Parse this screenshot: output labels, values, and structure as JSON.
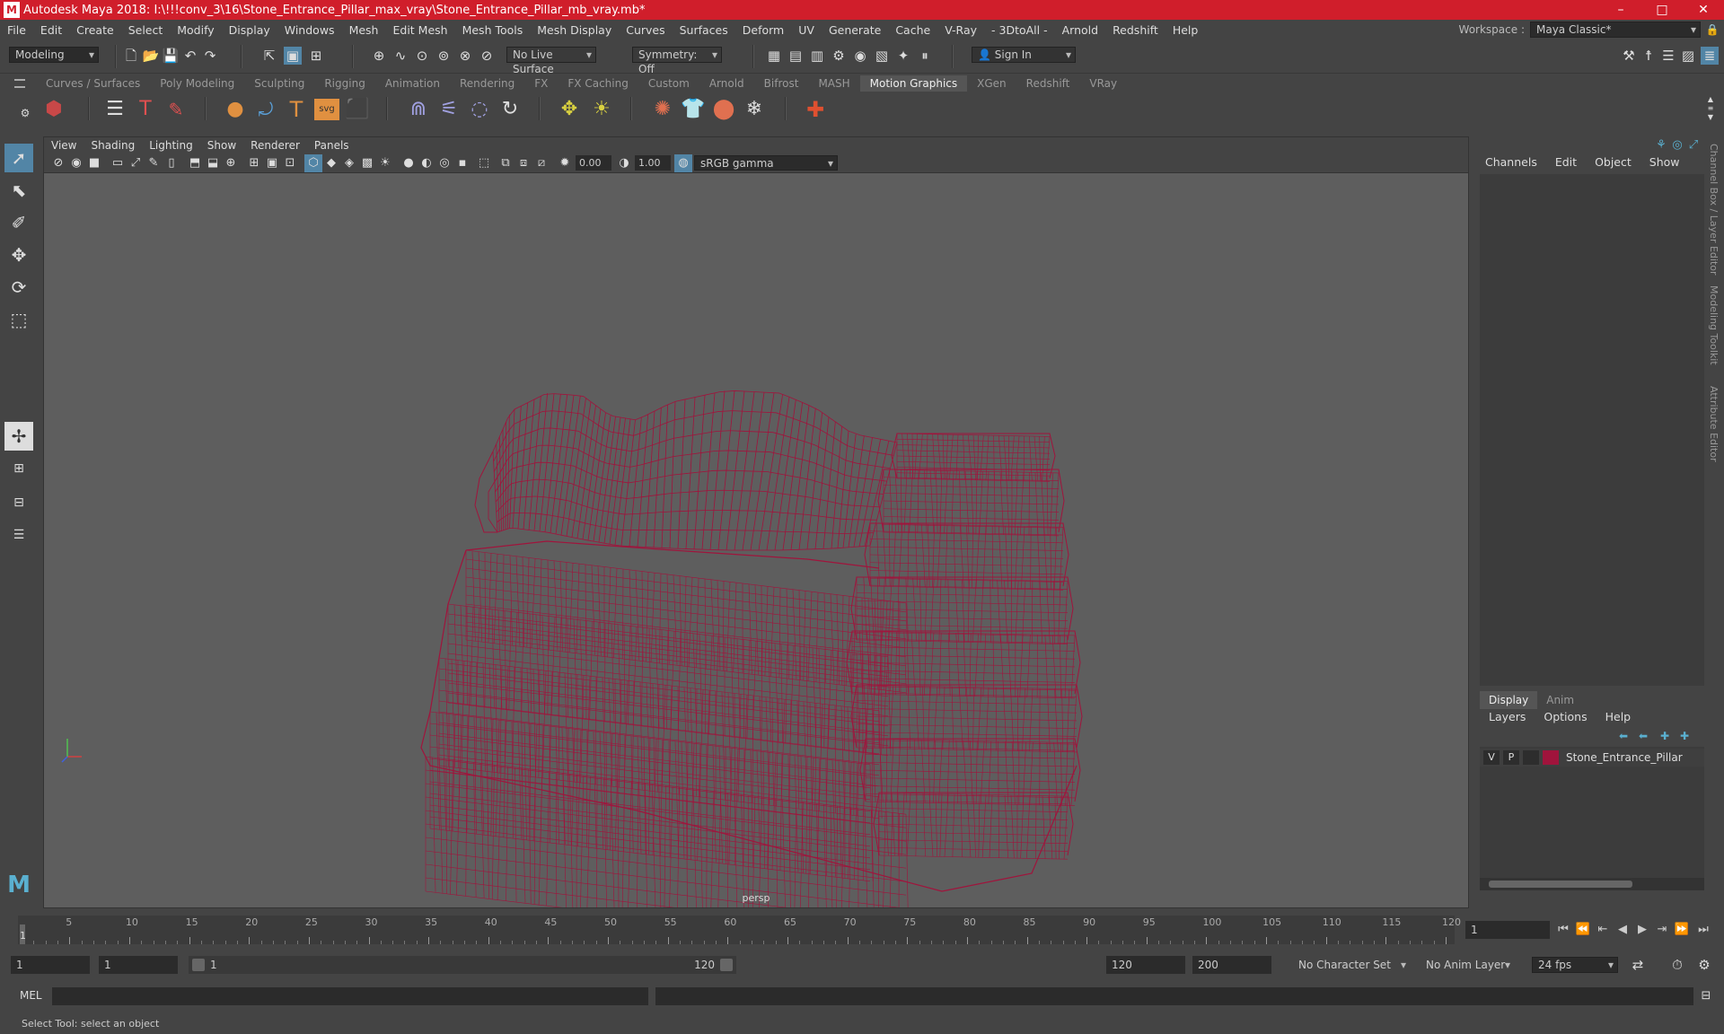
{
  "window": {
    "title": "Autodesk Maya 2018: I:\\!!!conv_3\\16\\Stone_Entrance_Pillar_max_vray\\Stone_Entrance_Pillar_mb_vray.mb*",
    "minimize": "–",
    "maximize": "□",
    "close": "✕"
  },
  "menubar": {
    "items": [
      "File",
      "Edit",
      "Create",
      "Select",
      "Modify",
      "Display",
      "Windows",
      "Mesh",
      "Edit Mesh",
      "Mesh Tools",
      "Mesh Display",
      "Curves",
      "Surfaces",
      "Deform",
      "UV",
      "Generate",
      "Cache",
      "V-Ray",
      "- 3DtoAll -",
      "Arnold",
      "Redshift",
      "Help"
    ],
    "workspace_label": "Workspace :",
    "workspace_value": "Maya Classic*"
  },
  "status_line": {
    "mode": "Modeling",
    "live_surface": "No Live Surface",
    "symmetry": "Symmetry: Off",
    "sign_in": "Sign In"
  },
  "shelf": {
    "tabs": [
      "Curves / Surfaces",
      "Poly Modeling",
      "Sculpting",
      "Rigging",
      "Animation",
      "Rendering",
      "FX",
      "FX Caching",
      "Custom",
      "Arnold",
      "Bifrost",
      "MASH",
      "Motion Graphics",
      "XGen",
      "Redshift",
      "VRay"
    ],
    "active_tab": "Motion Graphics"
  },
  "viewport": {
    "menu": [
      "View",
      "Shading",
      "Lighting",
      "Show",
      "Renderer",
      "Panels"
    ],
    "exposure": "0.00",
    "gamma": "1.00",
    "color_space": "sRGB gamma",
    "camera_label": "persp",
    "wire_color": "#a0143c"
  },
  "channel_box": {
    "menu": [
      "Channels",
      "Edit",
      "Object",
      "Show"
    ]
  },
  "layer_editor": {
    "tabs": [
      "Display",
      "Anim"
    ],
    "active_tab": "Display",
    "menu": [
      "Layers",
      "Options",
      "Help"
    ],
    "layers": [
      {
        "v": "V",
        "p": "P",
        "name": "Stone_Entrance_Pillar",
        "color": "#a0143c"
      }
    ]
  },
  "side_tabs": [
    "Channel Box / Layer Editor",
    "Modeling Toolkit",
    "Attribute Editor"
  ],
  "timeline": {
    "ticks": [
      "5",
      "10",
      "15",
      "20",
      "25",
      "30",
      "35",
      "40",
      "45",
      "50",
      "55",
      "60",
      "65",
      "70",
      "75",
      "80",
      "85",
      "90",
      "95",
      "100",
      "105",
      "110",
      "115",
      "120"
    ],
    "current_marker": "1",
    "current_frame": "1"
  },
  "range": {
    "start": "1",
    "playback_start": "1",
    "slider_start": "1",
    "slider_end": "120",
    "playback_end": "120",
    "end": "200",
    "character_set": "No Character Set",
    "anim_layer": "No Anim Layer",
    "fps": "24 fps"
  },
  "command_line": {
    "language": "MEL"
  },
  "help_line": "Select Tool: select an object"
}
